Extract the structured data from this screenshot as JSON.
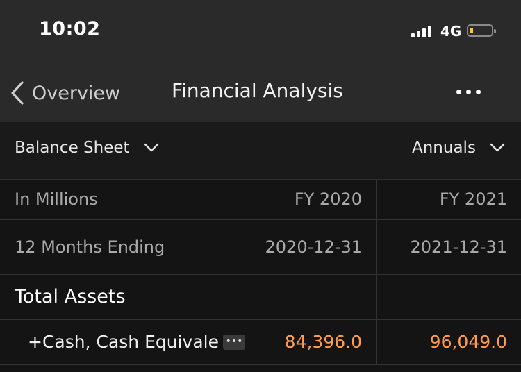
{
  "status_bar": {
    "time": "10:02",
    "network": "4G"
  },
  "nav": {
    "back_label": "Overview",
    "title": "Financial Analysis"
  },
  "selectors": {
    "statement": "Balance Sheet",
    "period": "Annuals"
  },
  "table": {
    "header": {
      "label": "In Millions",
      "col1": "FY 2020",
      "col2": "FY 2021"
    },
    "period_row": {
      "label": "12 Months Ending",
      "col1": "2020-12-31",
      "col2": "2021-12-31"
    },
    "rows": [
      {
        "label": "Total Assets",
        "col1": "",
        "col2": ""
      },
      {
        "label": "+Cash, Cash Equivale",
        "col1": "84,396.0",
        "col2": "96,049.0"
      }
    ]
  },
  "colors": {
    "value": "#ff9c4f",
    "battery": "#ffc52a",
    "bar_bg": "#2a2a2a"
  }
}
